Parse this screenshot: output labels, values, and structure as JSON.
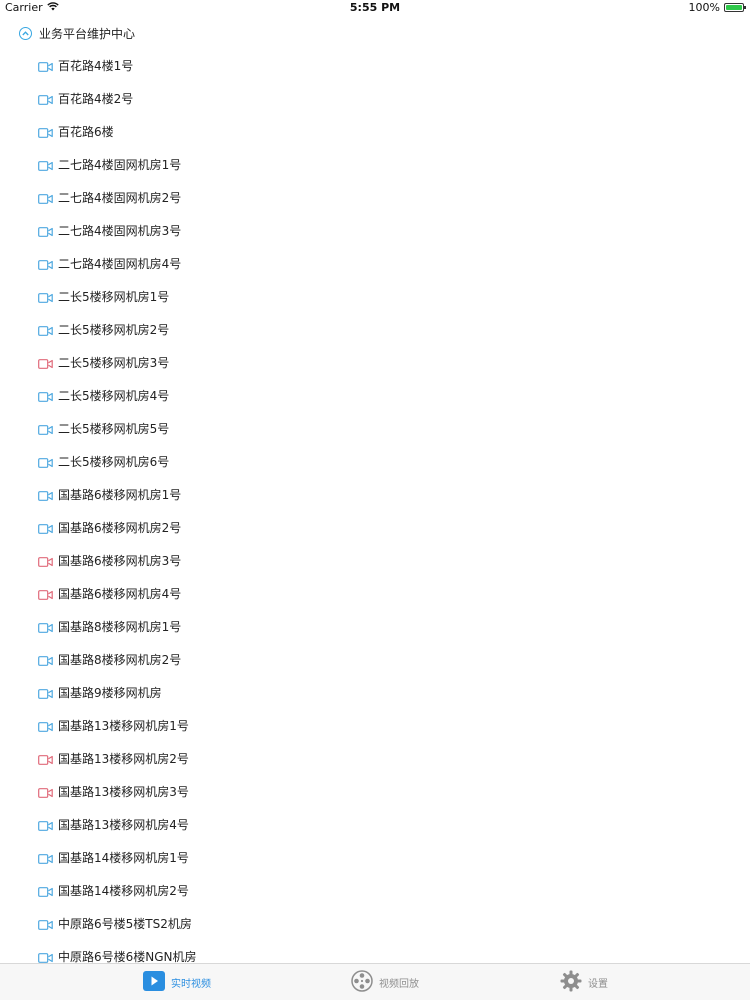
{
  "status_bar": {
    "carrier": "Carrier",
    "time": "5:55 PM",
    "battery": "100%"
  },
  "group": {
    "title": "业务平台维护中心",
    "icon": "chevron-up-circle-icon"
  },
  "colors": {
    "online": "#4ea8e0",
    "offline": "#e06a7a",
    "accent": "#2a8ee0"
  },
  "devices": [
    {
      "name": "百花路4楼1号",
      "status": "online"
    },
    {
      "name": "百花路4楼2号",
      "status": "online"
    },
    {
      "name": "百花路6楼",
      "status": "online"
    },
    {
      "name": "二七路4楼固网机房1号",
      "status": "online"
    },
    {
      "name": "二七路4楼固网机房2号",
      "status": "online"
    },
    {
      "name": "二七路4楼固网机房3号",
      "status": "online"
    },
    {
      "name": "二七路4楼固网机房4号",
      "status": "online"
    },
    {
      "name": "二长5楼移网机房1号",
      "status": "online"
    },
    {
      "name": "二长5楼移网机房2号",
      "status": "online"
    },
    {
      "name": "二长5楼移网机房3号",
      "status": "offline"
    },
    {
      "name": "二长5楼移网机房4号",
      "status": "online"
    },
    {
      "name": "二长5楼移网机房5号",
      "status": "online"
    },
    {
      "name": "二长5楼移网机房6号",
      "status": "online"
    },
    {
      "name": "国基路6楼移网机房1号",
      "status": "online"
    },
    {
      "name": "国基路6楼移网机房2号",
      "status": "online"
    },
    {
      "name": "国基路6楼移网机房3号",
      "status": "offline"
    },
    {
      "name": "国基路6楼移网机房4号",
      "status": "offline"
    },
    {
      "name": "国基路8楼移网机房1号",
      "status": "online"
    },
    {
      "name": "国基路8楼移网机房2号",
      "status": "online"
    },
    {
      "name": "国基路9楼移网机房",
      "status": "online"
    },
    {
      "name": "国基路13楼移网机房1号",
      "status": "online"
    },
    {
      "name": "国基路13楼移网机房2号",
      "status": "offline"
    },
    {
      "name": "国基路13楼移网机房3号",
      "status": "offline"
    },
    {
      "name": "国基路13楼移网机房4号",
      "status": "online"
    },
    {
      "name": "国基路14楼移网机房1号",
      "status": "online"
    },
    {
      "name": "国基路14楼移网机房2号",
      "status": "online"
    },
    {
      "name": "中原路6号楼5楼TS2机房",
      "status": "online"
    },
    {
      "name": "中原路6号楼6楼NGN机房",
      "status": "online"
    }
  ],
  "tabs": [
    {
      "label": "实时视频",
      "icon": "play-video-icon",
      "active": true
    },
    {
      "label": "视频回放",
      "icon": "film-reel-icon",
      "active": false
    },
    {
      "label": "设置",
      "icon": "gear-icon",
      "active": false
    }
  ]
}
